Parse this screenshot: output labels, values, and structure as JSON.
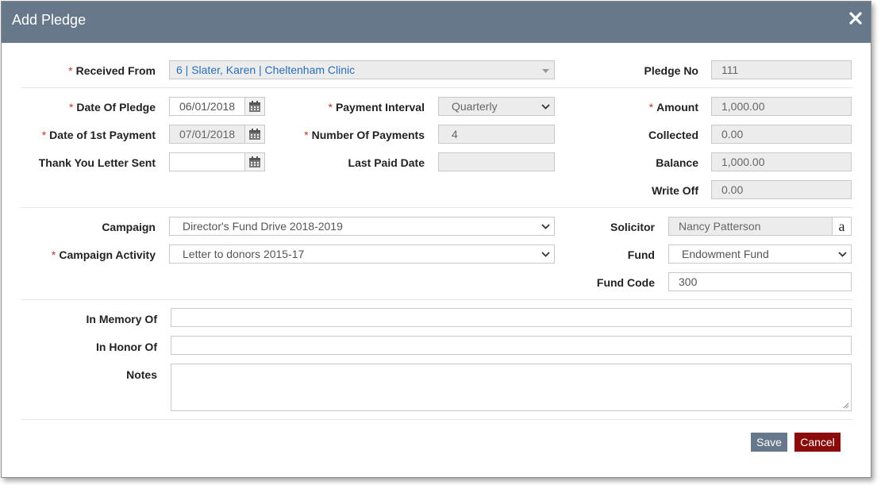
{
  "dialog": {
    "title": "Add Pledge"
  },
  "colors": {
    "titlebar": "#66788a",
    "required": "#c0392b",
    "cancel": "#8b0a0a",
    "save": "#66788a"
  },
  "form": {
    "received_from": {
      "label": "Received From",
      "value": "6 | Slater, Karen | Cheltenham Clinic",
      "required": true
    },
    "pledge_no": {
      "label": "Pledge No",
      "value": "111"
    },
    "date_of_pledge": {
      "label": "Date Of Pledge",
      "value": "06/01/2018",
      "required": true
    },
    "payment_interval": {
      "label": "Payment Interval",
      "value": "Quarterly",
      "required": true
    },
    "amount": {
      "label": "Amount",
      "value": "1,000.00",
      "required": true
    },
    "date_first_payment": {
      "label": "Date of 1st Payment",
      "value": "07/01/2018",
      "required": true
    },
    "number_of_payments": {
      "label": "Number Of Payments",
      "value": "4",
      "required": true
    },
    "collected": {
      "label": "Collected",
      "value": "0.00"
    },
    "thank_you_letter_sent": {
      "label": "Thank You Letter Sent",
      "value": ""
    },
    "last_paid_date": {
      "label": "Last Paid Date",
      "value": ""
    },
    "balance": {
      "label": "Balance",
      "value": "1,000.00"
    },
    "write_off": {
      "label": "Write Off",
      "value": "0.00"
    },
    "campaign": {
      "label": "Campaign",
      "value": "Director's Fund Drive 2018-2019"
    },
    "solicitor": {
      "label": "Solicitor",
      "value": "Nancy Patterson",
      "lookup_glyph": "a"
    },
    "campaign_activity": {
      "label": "Campaign Activity",
      "value": "Letter to donors 2015-17",
      "required": true
    },
    "fund": {
      "label": "Fund",
      "value": "Endowment Fund"
    },
    "fund_code": {
      "label": "Fund Code",
      "value": "300"
    },
    "in_memory_of": {
      "label": "In Memory Of",
      "value": ""
    },
    "in_honor_of": {
      "label": "In Honor Of",
      "value": ""
    },
    "notes": {
      "label": "Notes",
      "value": ""
    }
  },
  "required_marker": "*",
  "buttons": {
    "save": "Save",
    "cancel": "Cancel"
  },
  "icons": {
    "close": "close-icon",
    "calendar": "calendar-icon",
    "chevron": "chevron-down-icon",
    "lookup": "lookup-icon"
  }
}
